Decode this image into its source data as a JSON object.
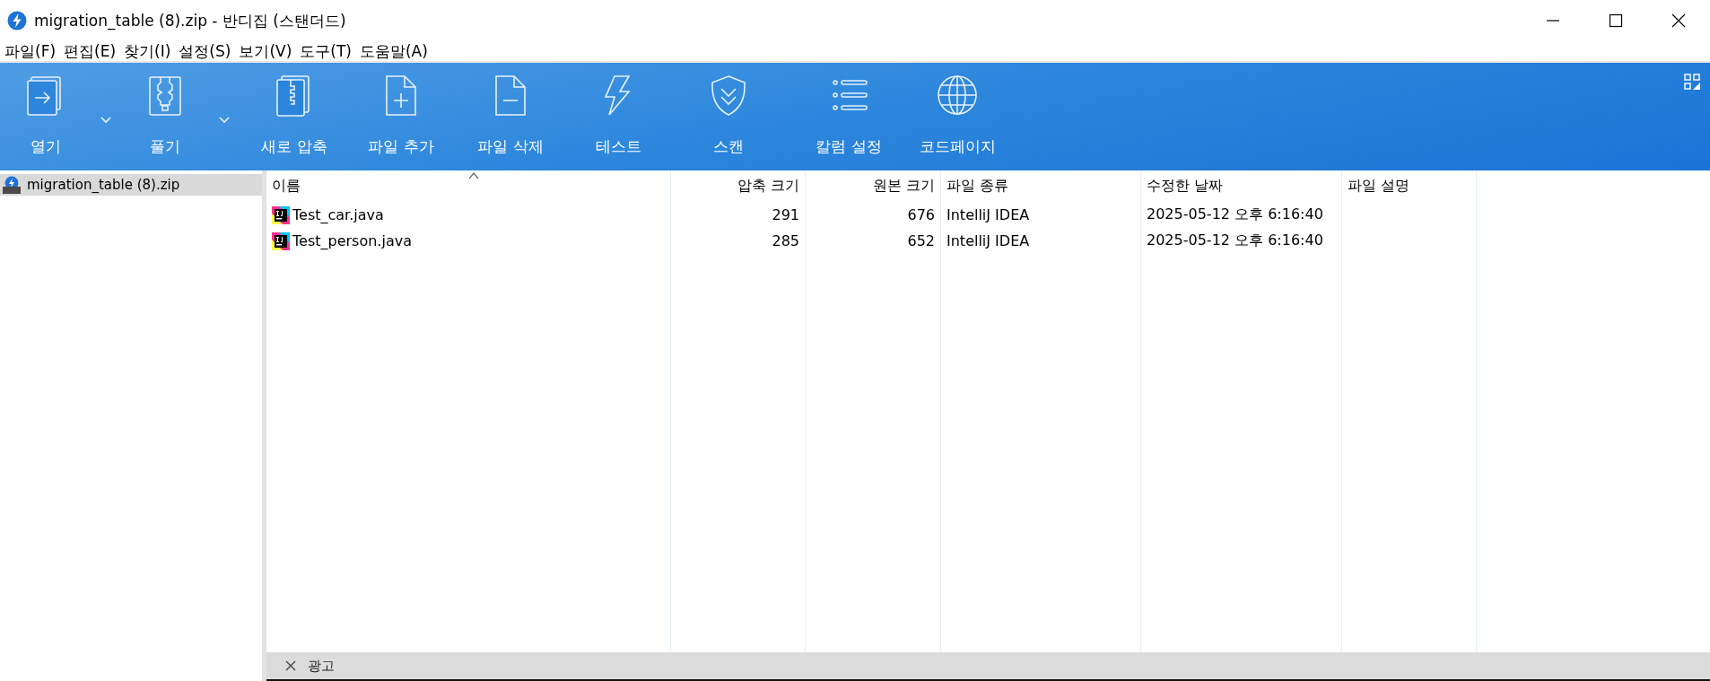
{
  "window": {
    "title": "migration_table (8).zip - 반디집 (스탠더드)"
  },
  "menu": [
    "파일(F)",
    "편집(E)",
    "찾기(I)",
    "설정(S)",
    "보기(V)",
    "도구(T)",
    "도움말(A)"
  ],
  "toolbar": [
    {
      "label": "열기",
      "dropdown": true
    },
    {
      "label": "풀기",
      "dropdown": true
    },
    {
      "label": "새로 압축",
      "dropdown": false
    },
    {
      "label": "파일 추가",
      "dropdown": false
    },
    {
      "label": "파일 삭제",
      "dropdown": false
    },
    {
      "label": "테스트",
      "dropdown": false
    },
    {
      "label": "스캔",
      "dropdown": false
    },
    {
      "label": "칼럼 설정",
      "dropdown": false
    },
    {
      "label": "코드페이지",
      "dropdown": false
    }
  ],
  "sidebar": {
    "items": [
      {
        "label": "migration_table (8).zip",
        "selected": true
      }
    ]
  },
  "table": {
    "columns": [
      {
        "label": "이름",
        "kind": "text",
        "sorted": true
      },
      {
        "label": "압축 크기",
        "kind": "number",
        "sorted": false
      },
      {
        "label": "원본 크기",
        "kind": "number",
        "sorted": false
      },
      {
        "label": "파일 종류",
        "kind": "text",
        "sorted": false
      },
      {
        "label": "수정한 날짜",
        "kind": "text",
        "sorted": false
      },
      {
        "label": "파일 설명",
        "kind": "text",
        "sorted": false
      }
    ],
    "rows": [
      [
        "Test_car.java",
        "291",
        "676",
        "IntelliJ IDEA",
        "2025-05-12 오후 6:16:40",
        ""
      ],
      [
        "Test_person.java",
        "285",
        "652",
        "IntelliJ IDEA",
        "2025-05-12 오후 6:16:40",
        ""
      ]
    ]
  },
  "ad_bar": {
    "label": "광고"
  }
}
